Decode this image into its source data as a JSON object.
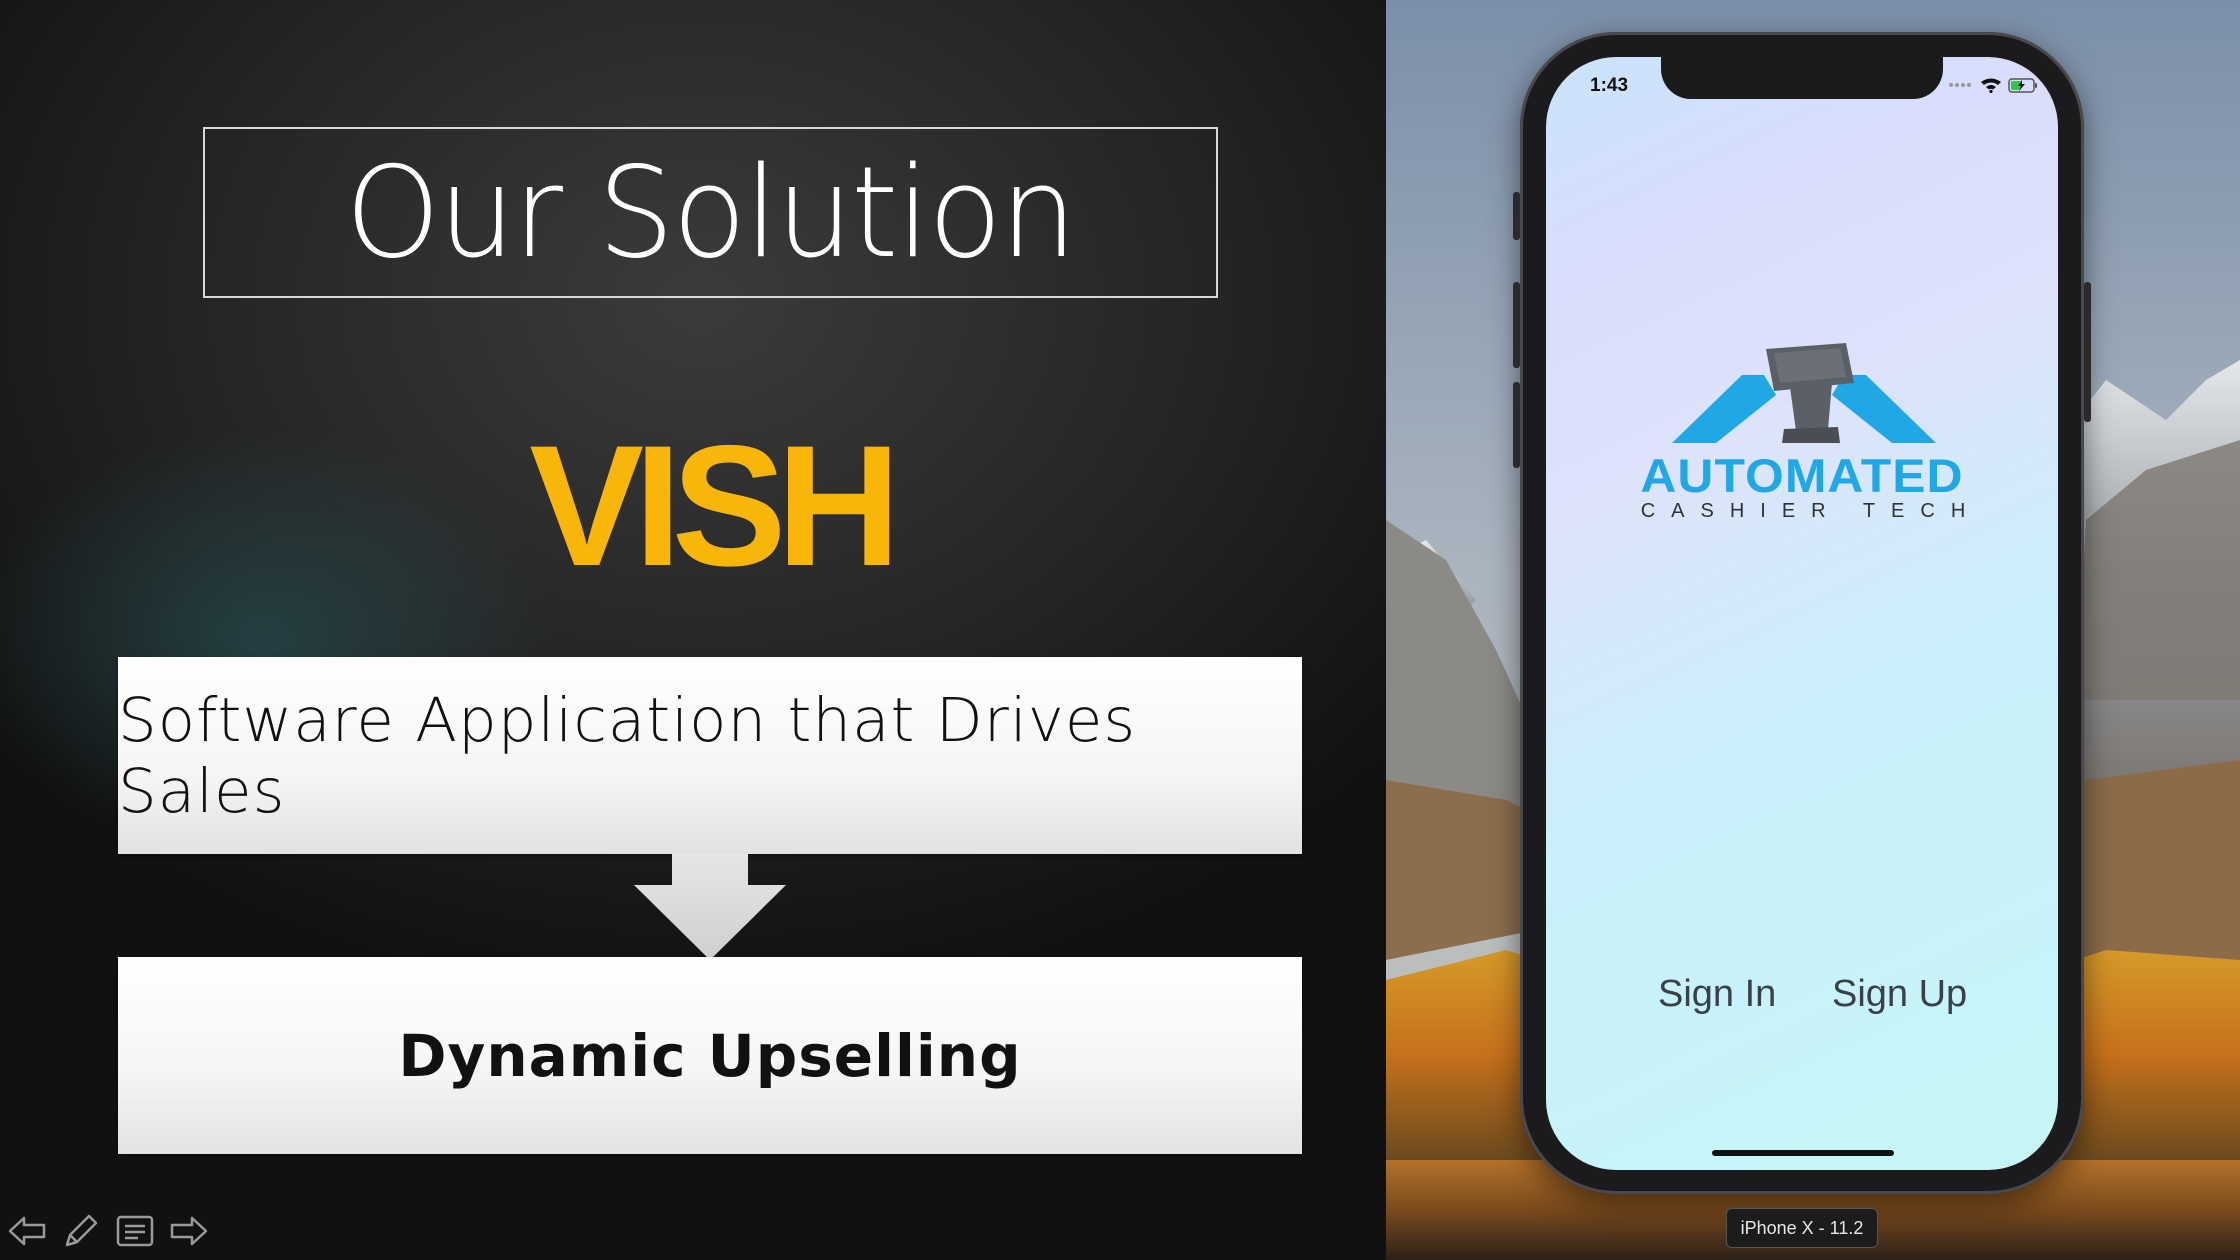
{
  "slide": {
    "title": "Our Solution",
    "brand": "VISH",
    "box_1": "Software Application that Drives Sales",
    "box_2": "Dynamic Upselling",
    "controls": [
      "previous-slide-icon",
      "pen-icon",
      "notes-icon",
      "next-slide-icon"
    ]
  },
  "simulator": {
    "status_time": "1:43",
    "status_icons": [
      "signal-dots-icon",
      "wifi-icon",
      "battery-charging-icon"
    ],
    "logo_word": "AUTOMATED",
    "logo_sub": "CASHIER TECH",
    "sign_in": "Sign In",
    "sign_up": "Sign Up",
    "device_label": "iPhone X - 11.2"
  },
  "colors": {
    "brand_yellow": "#f8b50a",
    "logo_blue": "#1fa7e6",
    "logo_gray": "#5a5e64"
  }
}
